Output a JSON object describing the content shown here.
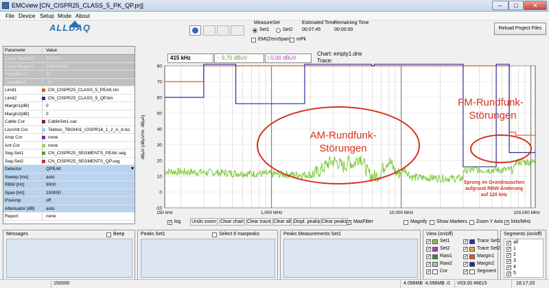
{
  "window": {
    "title": "EMCview [CN_CISPR25_CLASS_5_PK_QP.prj]",
    "min": "–",
    "max": "□",
    "close": "✕"
  },
  "menu": [
    "File",
    "Device",
    "Setup",
    "Mode",
    "About"
  ],
  "logo": "ALLDAQ",
  "measure_set": {
    "label": "MeasureSet",
    "opt1": "Set1",
    "opt2": "Set2",
    "emi": "EMI(ZeroSpan)",
    "mpk": "mPk"
  },
  "estimated": {
    "label": "Estimated Time",
    "value": "00:07:45"
  },
  "remaining": {
    "label": "Remaining Time",
    "value": "00:00:00"
  },
  "reload_button": "Reload Project Files",
  "params": {
    "header": {
      "k": "Parameter",
      "v": "Value"
    },
    "rows": [
      {
        "k": "Chart Start[Hz]",
        "v": "150000",
        "shade": "gray",
        "sw": ""
      },
      {
        "k": "Chart Stop[Hz]",
        "v": "108000000",
        "shade": "gray",
        "sw": ""
      },
      {
        "k": "High[dBuV]",
        "v": "80",
        "shade": "gray",
        "sw": ""
      },
      {
        "k": "Low[dBuV]",
        "v": "-10",
        "shade": "gray",
        "sw": ""
      },
      {
        "k": "Limit1",
        "v": "CN_CISPR25_CLASS_5_PEAK.lim",
        "shade": "white",
        "sw": "#e05a1e"
      },
      {
        "k": "Limit2",
        "v": "CN_CISPR25_CLASS_5_QP.lim",
        "shade": "white",
        "sw": "#2a2a9a"
      },
      {
        "k": "Margin1[dB]",
        "v": "0",
        "shade": "white",
        "sw": ""
      },
      {
        "k": "Margin2[dB]",
        "v": "0",
        "shade": "white",
        "sw": ""
      },
      {
        "k": "Cable Cor",
        "v": "CableSet1.cac",
        "shade": "white",
        "sw": "#7a2a2a"
      },
      {
        "k": "Lisn/Att Cor",
        "v": "Tekbox_TBOH01_CISPR16_1_2_A_8.lsc",
        "shade": "white",
        "sw": "#a6c8e8"
      },
      {
        "k": "Amp Cor",
        "v": "none",
        "shade": "white",
        "sw": "#7a2a9a"
      },
      {
        "k": "Ant Cor",
        "v": "none",
        "shade": "white",
        "sw": "#9ad27a"
      },
      {
        "k": "Seg-Set1",
        "v": "CN_CISPR25_SEGMENTS_PEAK.seg",
        "shade": "white",
        "sw": "#5a9a3a"
      },
      {
        "k": "Seg-Set2",
        "v": "CN_CISPR25_SEGMENTS_QP.seg",
        "shade": "white",
        "sw": "#c03a3a"
      },
      {
        "k": "Detector",
        "v": "QPEAK",
        "shade": "blue",
        "sw": ""
      },
      {
        "k": "Sweep [ms]",
        "v": "auto",
        "shade": "blue",
        "sw": ""
      },
      {
        "k": "RBW [Hz]",
        "v": "9000",
        "shade": "blue",
        "sw": ""
      },
      {
        "k": "Span [Hz]",
        "v": "100000",
        "shade": "blue",
        "sw": ""
      },
      {
        "k": "PreAmp",
        "v": "off",
        "shade": "blue",
        "sw": ""
      },
      {
        "k": "Attenuator [dB]",
        "v": "auto",
        "shade": "blue",
        "sw": ""
      },
      {
        "k": "Report",
        "v": "none",
        "shade": "white",
        "sw": ""
      }
    ]
  },
  "readouts": {
    "freq": "415 kHz",
    "set1": "~ 9,70 dBuV",
    "set2": "| 0,00 dBuV",
    "chart_file": "Chart: empty1.drw",
    "trace": "Trace:"
  },
  "chart": {
    "ylabel": "dBµV (dBµV/m, dBµA)",
    "yticks": [
      "80",
      "70",
      "60",
      "50",
      "40",
      "30",
      "20",
      "10",
      "0",
      "-10"
    ],
    "xticks": [
      "150 kHz",
      "1,000 MHz",
      "10,000 MHz",
      "100,000 MHz"
    ],
    "am_label": "AM-Rundfunk-\nStörungen",
    "fm_label": "FM-Rundfunk-\nStörungen",
    "note": "Sprung im Grundrauschen\naufgrund RBW-Änderung\nauf 120 kHz",
    "colors": {
      "trace": "#7cc93a",
      "peak_limit": "#e05a1e",
      "qp_limit": "#2a2a9a",
      "annot": "#d7301c"
    }
  },
  "chart_controls": {
    "log": "log",
    "undo": "Undo zoom",
    "clear_chart": "Clear chart",
    "clear_trace": "Clear trace",
    "clear_all": "Clear all",
    "displ": "Displ. peaks",
    "clear_peaks": "Clear peaks",
    "maxfilter": "MaxFilter",
    "magnify": "Magnify",
    "markers": "Show Markers",
    "zoomy": "Zoom Y Axis",
    "khz": "kHz/MHz"
  },
  "messages": {
    "title": "Messages",
    "beep": "Beep"
  },
  "peaks": {
    "title": "Peaks Set1",
    "select": "Select 6 maxpeaks"
  },
  "peaks_meas": {
    "title": "Peaks Measurements Set1"
  },
  "view": {
    "title": "View (on/off)",
    "items": [
      [
        "Set1",
        "#7cc93a"
      ],
      [
        "Set2",
        "#b03ab0"
      ],
      [
        "Raw1",
        "#3a8a3a"
      ],
      [
        "Raw2",
        "#bbbbbb"
      ],
      [
        "Cor",
        "#ffffff"
      ],
      [
        "Trace Set1",
        "#2a2a9a"
      ],
      [
        "Trace Set2",
        "#e0b030"
      ],
      [
        "Margin1",
        "#e05a1e"
      ],
      [
        "Margin2",
        "#2a2a9a"
      ],
      [
        "Segment",
        "#ffffff"
      ]
    ]
  },
  "segments": {
    "title": "Segments (on/off)",
    "items": [
      "all",
      "1",
      "2",
      "3",
      "4",
      "5"
    ]
  },
  "status": {
    "value": "150000",
    "mem": "4.096MB :4.096MB :0",
    "version": "V03.00 #6615",
    "time": "18:17:20"
  }
}
